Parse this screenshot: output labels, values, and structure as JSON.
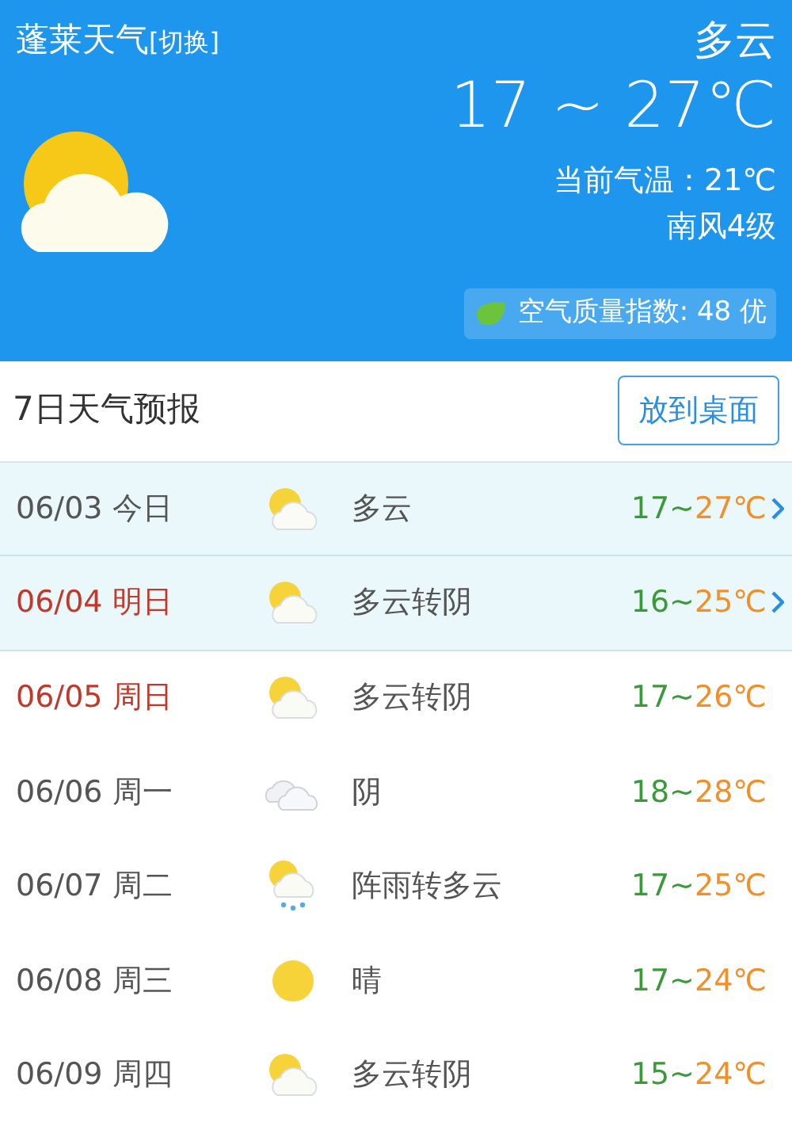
{
  "header": {
    "city": "蓬莱天气",
    "switch_link": "[切换]",
    "condition": "多云",
    "temp_range": "17 ~ 27℃",
    "current_temp": "当前气温：21℃",
    "wind": "南风4级",
    "aqi": "空气质量指数: 48 优"
  },
  "forecast": {
    "title": "7日天气预报",
    "desktop_button": "放到桌面",
    "days": [
      {
        "date": "06/03 今日",
        "holiday": false,
        "highlighted": true,
        "kind": "partly-cloudy",
        "condition": "多云",
        "low": "17~",
        "high": "27℃"
      },
      {
        "date": "06/04 明日",
        "holiday": true,
        "highlighted": true,
        "kind": "partly-cloudy",
        "condition": "多云转阴",
        "low": "16~",
        "high": "25℃"
      },
      {
        "date": "06/05 周日",
        "holiday": true,
        "highlighted": false,
        "kind": "partly-cloudy",
        "condition": "多云转阴",
        "low": "17~",
        "high": "26℃"
      },
      {
        "date": "06/06 周一",
        "holiday": false,
        "highlighted": false,
        "kind": "overcast",
        "condition": "阴",
        "low": "18~",
        "high": "28℃"
      },
      {
        "date": "06/07 周二",
        "holiday": false,
        "highlighted": false,
        "kind": "shower",
        "condition": "阵雨转多云",
        "low": "17~",
        "high": "25℃"
      },
      {
        "date": "06/08 周三",
        "holiday": false,
        "highlighted": false,
        "kind": "sunny",
        "condition": "晴",
        "low": "17~",
        "high": "24℃"
      },
      {
        "date": "06/09 周四",
        "holiday": false,
        "highlighted": false,
        "kind": "partly-cloudy",
        "condition": "多云转阴",
        "low": "15~",
        "high": "24℃"
      }
    ]
  }
}
